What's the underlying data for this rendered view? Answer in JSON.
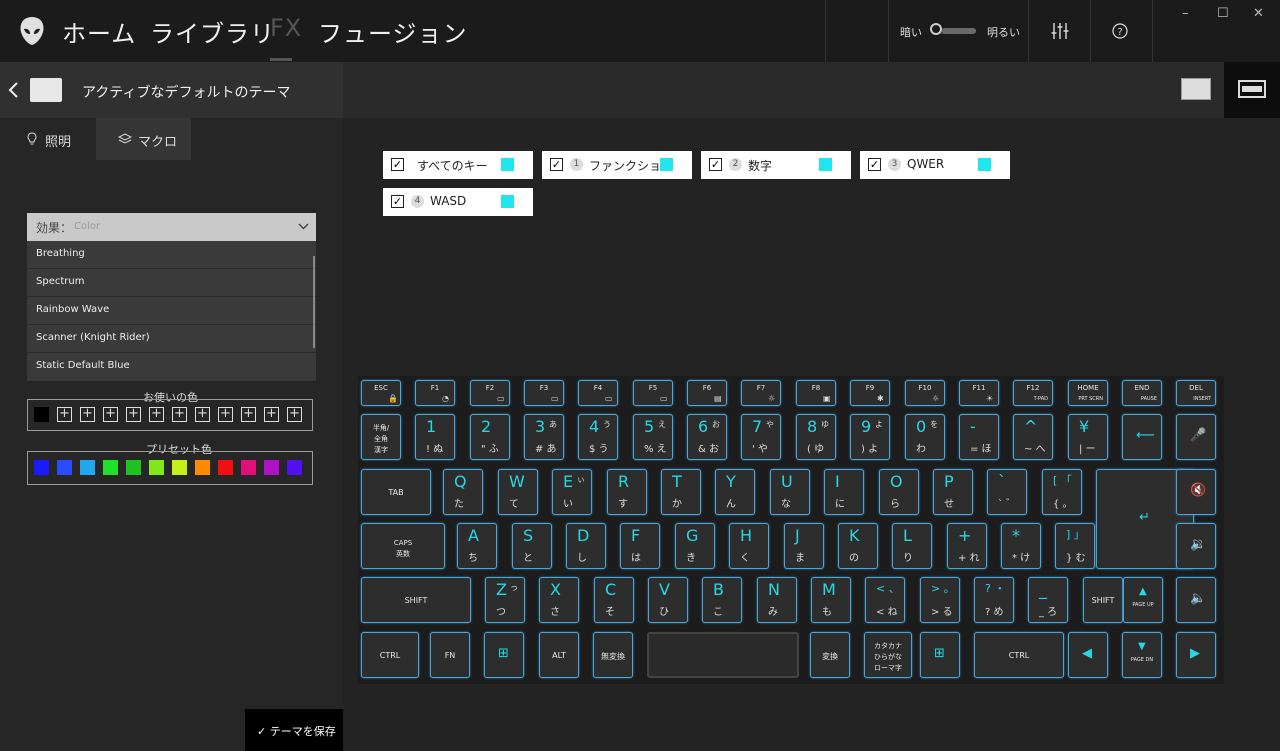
{
  "nav": {
    "items": [
      "ホーム",
      "ライブラリ",
      "FX",
      "フュージョン"
    ],
    "active": "FX",
    "theme_dark": "暗い",
    "theme_light": "明るい",
    "window_controls": [
      "–",
      "☐",
      "✕"
    ],
    "icons": [
      "alienware-logo-icon",
      "equalizer-icon",
      "help-icon"
    ]
  },
  "header": {
    "back_icon": "chevron-left-icon",
    "theme_name": "アクティブなデフォルトのテーマ"
  },
  "left_panel": {
    "tabs": [
      {
        "label": "照明",
        "icon": "bulb-icon"
      },
      {
        "label": "マクロ",
        "icon": "layers-icon"
      }
    ],
    "effect_label": "効果：",
    "effect_value": "Color",
    "effect_options": [
      "Breathing",
      "Spectrum",
      "Rainbow Wave",
      "Scanner (Knight Rider)",
      "Static Default Blue"
    ],
    "your_colors_title": "お使いの色",
    "your_colors": [
      "#000000",
      "+",
      "+",
      "+",
      "+",
      "+",
      "+",
      "+",
      "+",
      "+",
      "+",
      "+"
    ],
    "preset_title": "プリセット色",
    "preset_colors": [
      "#1a1aff",
      "#2b4bff",
      "#22a6ee",
      "#1fe12a",
      "#1fc21f",
      "#80e81a",
      "#c6f01a",
      "#ff8c00",
      "#f01010",
      "#e0107a",
      "#b010c8",
      "#5010f0"
    ],
    "save_label": "✓ テーマを保存"
  },
  "zones": [
    {
      "num": "",
      "name": "すべてのキー",
      "checked": "✓",
      "color": "#22e6ee"
    },
    {
      "num": "1",
      "name": "ファンクショ...",
      "checked": "✓",
      "color": "#22e6ee"
    },
    {
      "num": "2",
      "name": "数字",
      "checked": "✓",
      "color": "#22e6ee"
    },
    {
      "num": "3",
      "name": "QWER",
      "checked": "✓",
      "color": "#22e6ee"
    },
    {
      "num": "4",
      "name": "WASD",
      "checked": "✓",
      "color": "#22e6ee"
    }
  ],
  "keyboard": {
    "rows": [
      [
        {
          "l": "ESC",
          "i": "🔒"
        },
        {
          "l": "F1",
          "i": "◔"
        },
        {
          "l": "F2",
          "i": "▭"
        },
        {
          "l": "F3",
          "i": "▭"
        },
        {
          "l": "F4",
          "i": "▭"
        },
        {
          "l": "F5",
          "i": "▭"
        },
        {
          "l": "F6",
          "i": "▤"
        },
        {
          "l": "F7",
          "i": "☼"
        },
        {
          "l": "F8",
          "i": "▣"
        },
        {
          "l": "F9",
          "i": "✱"
        },
        {
          "l": "F10",
          "i": "☼"
        },
        {
          "l": "F11",
          "i": "☀"
        },
        {
          "l": "F12",
          "s": "T-PAD"
        },
        {
          "l": "HOME",
          "s": "PRT SCRN"
        },
        {
          "l": "END",
          "s": "PAUSE"
        },
        {
          "l": "DEL",
          "s": "INSERT"
        }
      ],
      [
        {
          "l": "半角/\n全角\n漢字"
        },
        {
          "m": "1",
          "a": "! ぬ"
        },
        {
          "m": "2",
          "a": "\" ふ"
        },
        {
          "m": "3",
          "k": "あ",
          "a": "# あ"
        },
        {
          "m": "4",
          "k": "う",
          "a": "$ う"
        },
        {
          "m": "5",
          "k": "え",
          "a": "% え"
        },
        {
          "m": "6",
          "k": "お",
          "a": "& お"
        },
        {
          "m": "7",
          "k": "や",
          "a": "' や"
        },
        {
          "m": "8",
          "k": "ゆ",
          "a": "( ゆ"
        },
        {
          "m": "9",
          "k": "よ",
          "a": ") よ"
        },
        {
          "m": "0",
          "k": "を",
          "a": "わ"
        },
        {
          "m": "-",
          "a": "= ほ"
        },
        {
          "m": "^",
          "a": "~ へ"
        },
        {
          "m": "¥",
          "a": "| ー"
        },
        {
          "i": "⟵"
        },
        {
          "i": "🎤"
        }
      ],
      [
        {
          "l": "TAB"
        },
        {
          "m": "Q",
          "a": "た"
        },
        {
          "m": "W",
          "a": "て"
        },
        {
          "m": "E",
          "k": "ぃ",
          "a": "い"
        },
        {
          "m": "R",
          "a": "す"
        },
        {
          "m": "T",
          "a": "か"
        },
        {
          "m": "Y",
          "a": "ん"
        },
        {
          "m": "U",
          "a": "な"
        },
        {
          "m": "I",
          "a": "に"
        },
        {
          "m": "O",
          "a": "ら"
        },
        {
          "m": "P",
          "a": "せ"
        },
        {
          "m": "`",
          "a": "` ゛"
        },
        {
          "m": "[ 「",
          "a": "{ 。"
        },
        {
          "i": "↵"
        },
        {
          "i": "🔇"
        }
      ],
      [
        {
          "l": "CAPS\n英数"
        },
        {
          "m": "A",
          "a": "ち"
        },
        {
          "m": "S",
          "a": "と"
        },
        {
          "m": "D",
          "a": "し"
        },
        {
          "m": "F",
          "a": "は"
        },
        {
          "m": "G",
          "a": "き"
        },
        {
          "m": "H",
          "a": "く"
        },
        {
          "m": "J",
          "a": "ま"
        },
        {
          "m": "K",
          "a": "の"
        },
        {
          "m": "L",
          "a": "り"
        },
        {
          "m": "+",
          "a": "+ れ"
        },
        {
          "m": "*",
          "a": "* け"
        },
        {
          "m": "] 」",
          "a": "} む"
        },
        {
          "i": "🔉"
        }
      ],
      [
        {
          "l": "SHIFT"
        },
        {
          "m": "Z",
          "k": "っ",
          "a": "つ"
        },
        {
          "m": "X",
          "a": "さ"
        },
        {
          "m": "C",
          "a": "そ"
        },
        {
          "m": "V",
          "a": "ひ"
        },
        {
          "m": "B",
          "a": "こ"
        },
        {
          "m": "N",
          "a": "み"
        },
        {
          "m": "M",
          "a": "も"
        },
        {
          "m": "< 、",
          "a": "< ね"
        },
        {
          "m": "> 。",
          "a": "> る"
        },
        {
          "m": "? ・",
          "a": "? め"
        },
        {
          "m": "_",
          "a": "_ ろ"
        },
        {
          "l": "SHIFT"
        },
        {
          "i": "▲",
          "s": "PAGE UP"
        },
        {
          "i": "🔈"
        }
      ],
      [
        {
          "l": "CTRL"
        },
        {
          "l": "FN"
        },
        {
          "i": "⊞"
        },
        {
          "l": "ALT"
        },
        {
          "l": "無変換"
        },
        {
          "l": ""
        },
        {
          "l": "変換"
        },
        {
          "l": "カタカナ\nひらがな\nローマ字"
        },
        {
          "i": "⊞"
        },
        {
          "l": "CTRL"
        },
        {
          "i": "◀"
        },
        {
          "i": "▼",
          "s": "PAGE DN"
        },
        {
          "i": "▶"
        }
      ]
    ]
  }
}
